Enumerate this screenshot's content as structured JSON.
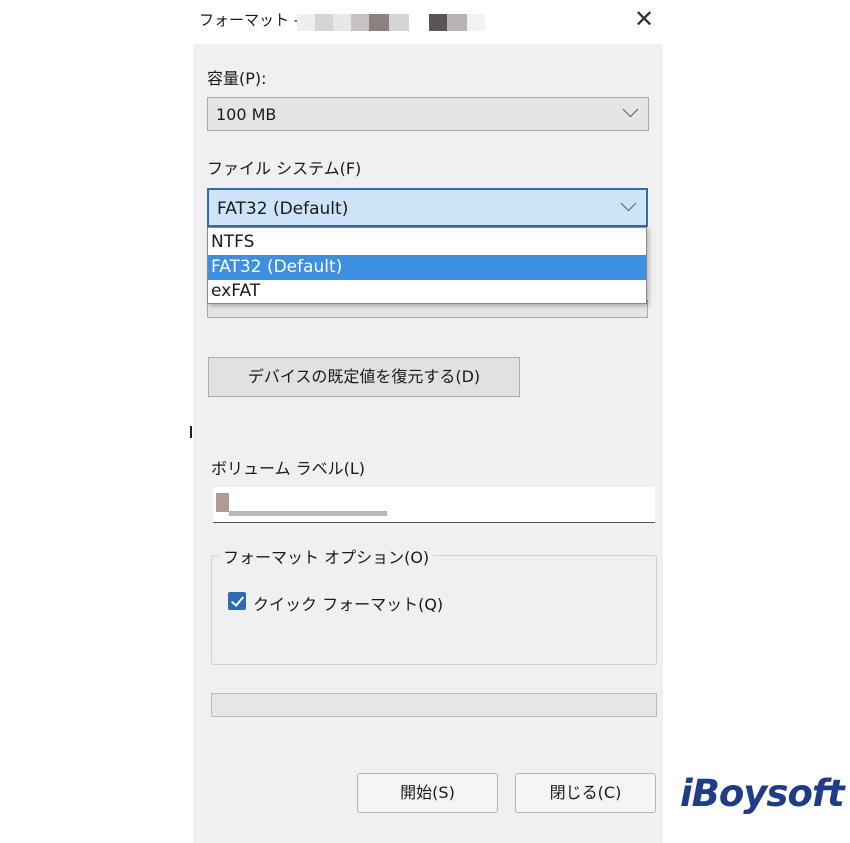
{
  "window": {
    "title": "フォーマット -",
    "close_glyph": "✕"
  },
  "capacity": {
    "label": "容量(P):",
    "value": "100 MB"
  },
  "file_system": {
    "label": "ファイル システム(F)",
    "value": "FAT32 (Default)",
    "options": [
      "NTFS",
      "FAT32 (Default)",
      "exFAT"
    ],
    "selected_index": 1
  },
  "restore_defaults_button": "デバイスの既定値を復元する(D)",
  "volume_label": {
    "label": "ボリューム ラベル(L)",
    "value": ""
  },
  "format_options": {
    "title": "フォーマット オプション(O)",
    "quick_format": {
      "label": "クイック フォーマット(Q)",
      "checked": true
    }
  },
  "progress": {
    "value": 0
  },
  "buttons": {
    "start": "開始(S)",
    "close": "閉じる(C)"
  },
  "watermark": "iBoysoft",
  "colors": {
    "accent": "#2d6bb3",
    "selection": "#3d8fe0",
    "dialog_bg": "#f0f0f0",
    "logo": "#1f3c89"
  }
}
